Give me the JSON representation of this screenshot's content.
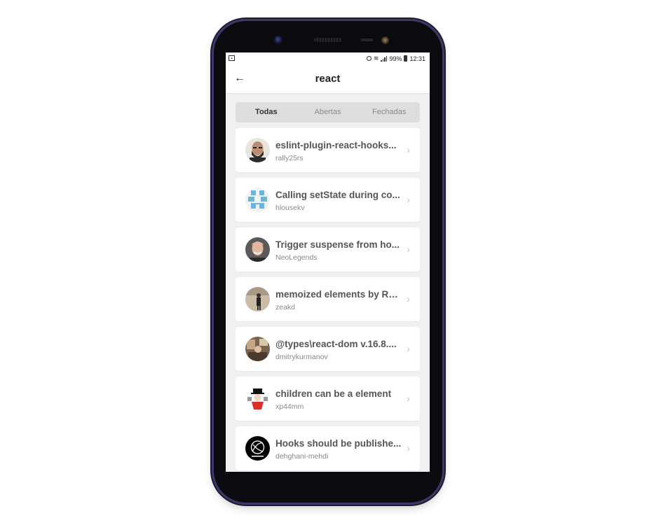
{
  "status": {
    "battery": "99%",
    "time": "12:31"
  },
  "header": {
    "back_icon": "←",
    "title": "react"
  },
  "tabs": [
    {
      "label": "Todas",
      "active": true
    },
    {
      "label": "Abertas",
      "active": false
    },
    {
      "label": "Fechadas",
      "active": false
    }
  ],
  "issues": [
    {
      "title": "eslint-plugin-react-hooks...",
      "user": "rally25rs",
      "avatar": "photo-bearded-man"
    },
    {
      "title": "Calling setState during co...",
      "user": "hlousekv",
      "avatar": "identicon-blue"
    },
    {
      "title": "Trigger suspense from ho...",
      "user": "NeoLegends",
      "avatar": "photo-smiling-man"
    },
    {
      "title": "memoized elements by Re...",
      "user": "zeakd",
      "avatar": "photo-standing-person"
    },
    {
      "title": "@types\\react-dom v.16.8....",
      "user": "dmitrykurmanov",
      "avatar": "photo-room"
    },
    {
      "title": "children can be a element",
      "user": "xp44mm",
      "avatar": "illustration-character"
    },
    {
      "title": "Hooks should be publishe...",
      "user": "dehghani-mehdi",
      "avatar": "logo-black-circle"
    }
  ],
  "chevron": "›"
}
